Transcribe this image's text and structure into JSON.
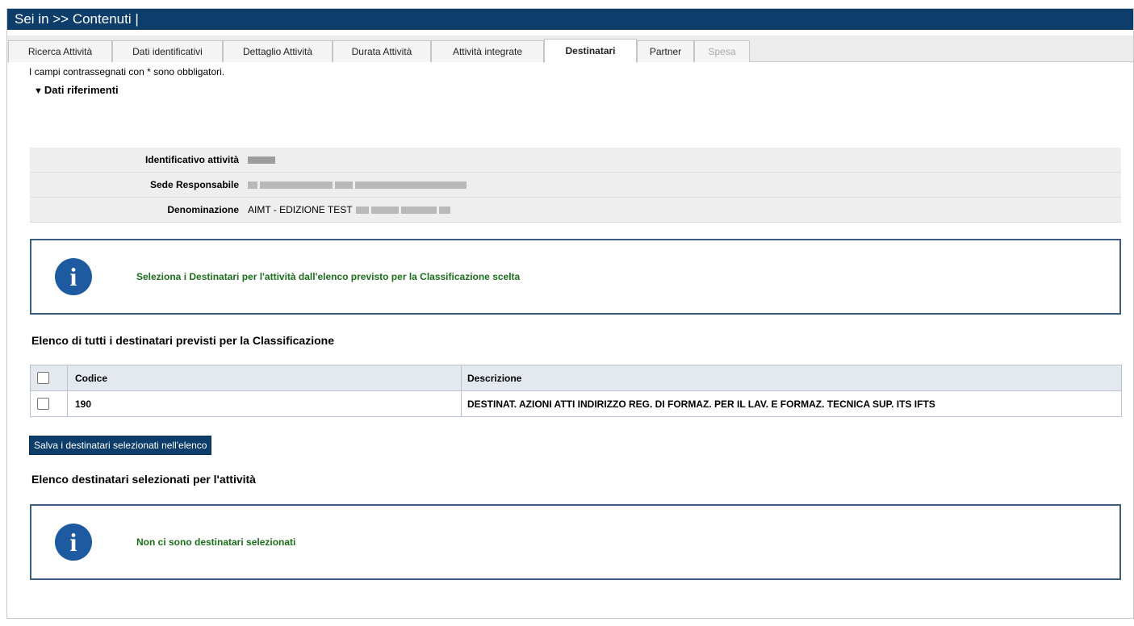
{
  "header": {
    "title": "Sei in >> Contenuti |"
  },
  "tabs": [
    {
      "label": "Ricerca Attività",
      "state": "normal"
    },
    {
      "label": "Dati identificativi",
      "state": "normal"
    },
    {
      "label": "Dettaglio Attività",
      "state": "normal"
    },
    {
      "label": "Durata Attività",
      "state": "normal"
    },
    {
      "label": "Attività integrate",
      "state": "normal"
    },
    {
      "label": "Destinatari",
      "state": "active"
    },
    {
      "label": "Partner",
      "state": "normal"
    },
    {
      "label": "Spesa",
      "state": "disabled"
    }
  ],
  "form": {
    "mandatory_note": "I campi contrassegnati con * sono obbligatori."
  },
  "section": {
    "toggle_icon": "triangle-down-icon",
    "title": "Dati riferimenti",
    "rows": [
      {
        "label": "Identificativo attività",
        "value": ""
      },
      {
        "label": "Sede Responsabile",
        "value": ""
      },
      {
        "label": "Denominazione",
        "value": "AIMT - EDIZIONE TEST"
      }
    ]
  },
  "info_messages": {
    "select_hint": "Seleziona i Destinatari per l'attività dall'elenco previsto per la Classificazione scelta",
    "none_selected": "Non ci sono destinatari selezionati"
  },
  "available_list": {
    "title": "Elenco di tutti i destinatari previsti per la Classificazione",
    "columns": [
      "Codice",
      "Descrizione"
    ],
    "rows": [
      {
        "code": "190",
        "description": "DESTINAT. AZIONI ATTI INDIRIZZO REG. DI FORMAZ. PER IL LAV. E FORMAZ. TECNICA SUP. ITS IFTS",
        "checked": false
      }
    ]
  },
  "save_button": {
    "label": "Salva i destinatari selezionati nell'elenco"
  },
  "selected_list": {
    "title": "Elenco destinatari selezionati per l'attività"
  },
  "colors": {
    "header_bg": "#0d3d6b",
    "info_text": "#1b6e1b",
    "info_icon": "#1e5aa0",
    "info_border": "#3b5f80"
  }
}
